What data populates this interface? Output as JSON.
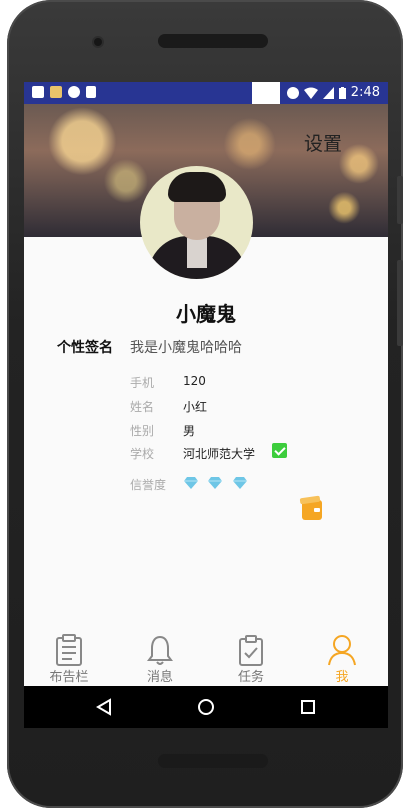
{
  "status_bar": {
    "time": "2:48",
    "colors": {
      "background": "#283593"
    }
  },
  "header": {
    "settings_label": "设置"
  },
  "profile": {
    "name": "小魔鬼",
    "signature_label": "个性签名",
    "signature_value": "我是小魔鬼哈哈哈",
    "fields": [
      {
        "label": "手机",
        "value": "120"
      },
      {
        "label": "姓名",
        "value": "小红"
      },
      {
        "label": "性别",
        "value": "男"
      },
      {
        "label": "学校",
        "value": "河北师范大学"
      }
    ],
    "school_verified": true,
    "credit_label": "信誉度",
    "credit_diamonds": 3
  },
  "tabs": [
    {
      "label": "布告栏",
      "icon": "clipboard-icon",
      "active": false
    },
    {
      "label": "消息",
      "icon": "bell-icon",
      "active": false
    },
    {
      "label": "任务",
      "icon": "task-icon",
      "active": false
    },
    {
      "label": "我",
      "icon": "person-icon",
      "active": true
    }
  ],
  "colors": {
    "accent": "#f5a623",
    "verified_green": "#3ccd3c",
    "diamond": "#6ec6e6"
  }
}
